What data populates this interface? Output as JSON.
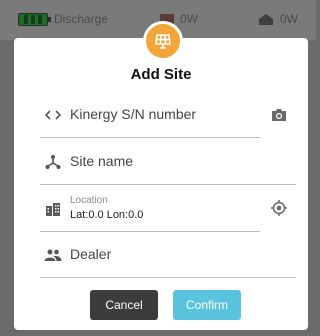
{
  "statusbar": {
    "discharge_label": "Discharge",
    "power1_value": "0W",
    "power2_value": "0W"
  },
  "dialog": {
    "title": "Add Site",
    "fields": {
      "serial_placeholder": "Kinergy S/N number",
      "site_name_placeholder": "Site name",
      "location_label": "Location",
      "location_value": "Lat:0.0 Lon:0.0",
      "dealer_placeholder": "Dealer"
    },
    "buttons": {
      "cancel": "Cancel",
      "confirm": "Confirm"
    }
  },
  "icons": {
    "badge": "solar-panel-icon",
    "serial": "code-brackets-icon",
    "camera": "camera-icon",
    "site": "sites-tree-icon",
    "location": "building-icon",
    "gps": "gps-target-icon",
    "dealer": "people-icon"
  },
  "colors": {
    "badge": "#f3a53a",
    "confirm": "#5ac4de",
    "cancel": "#3c3c3c"
  }
}
